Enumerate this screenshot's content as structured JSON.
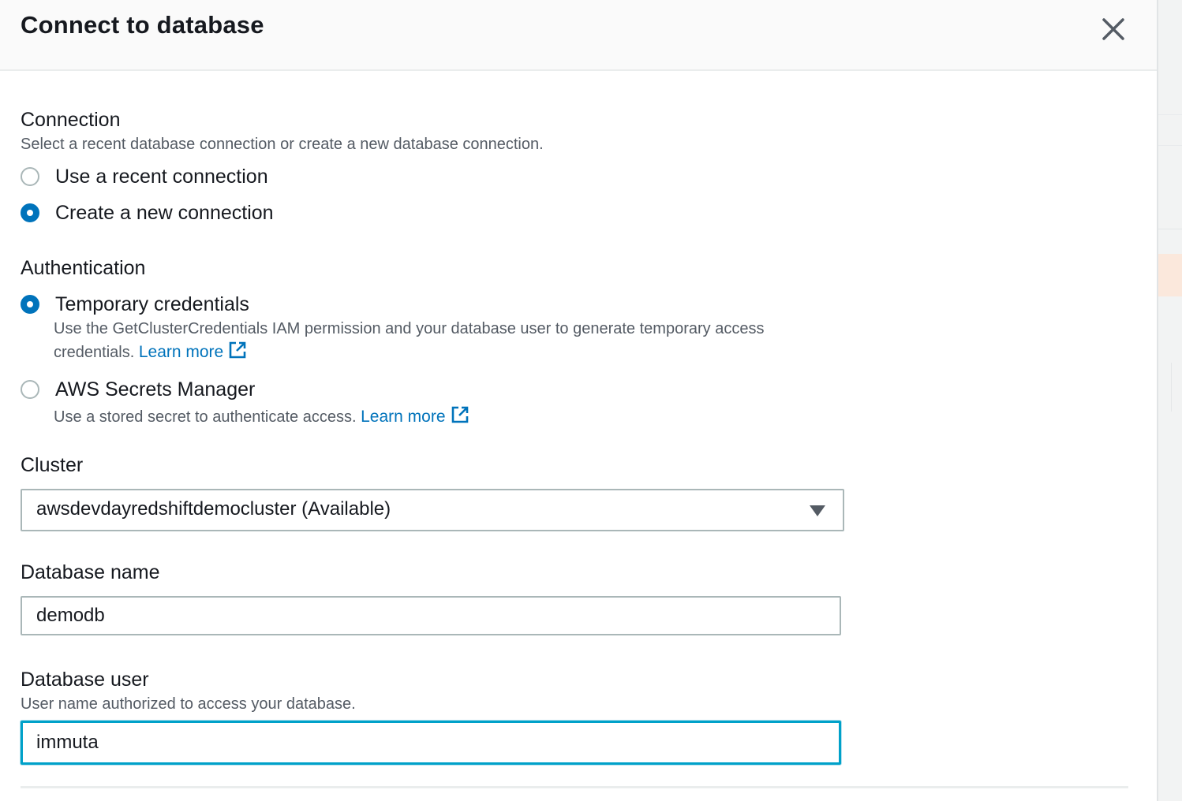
{
  "modal": {
    "title": "Connect to database",
    "close_icon": "close-icon"
  },
  "connection": {
    "label": "Connection",
    "description": "Select a recent database connection or create a new database connection.",
    "options": [
      {
        "label": "Use a recent connection",
        "selected": false
      },
      {
        "label": "Create a new connection",
        "selected": true
      }
    ]
  },
  "authentication": {
    "label": "Authentication",
    "options": [
      {
        "label": "Temporary credentials",
        "selected": true,
        "description_line1": "Use the GetClusterCredentials IAM permission and your database user to generate temporary access",
        "description_line2": "credentials.",
        "link": "Learn more"
      },
      {
        "label": "AWS Secrets Manager",
        "selected": false,
        "description": "Use a stored secret to authenticate access.",
        "link": "Learn more"
      }
    ]
  },
  "cluster": {
    "label": "Cluster",
    "selected_value": "awsdevdayredshiftdemocluster (Available)"
  },
  "database_name": {
    "label": "Database name",
    "value": "demodb"
  },
  "database_user": {
    "label": "Database user",
    "description": "User name authorized to access your database.",
    "value": "immuta"
  },
  "colors": {
    "accent": "#0073bb",
    "focus": "#00a1c9",
    "text": "#16191f",
    "muted": "#545b64",
    "border": "#aab7b8"
  },
  "icons": {
    "external_link": "external-link-icon",
    "dropdown": "caret-down-icon"
  }
}
